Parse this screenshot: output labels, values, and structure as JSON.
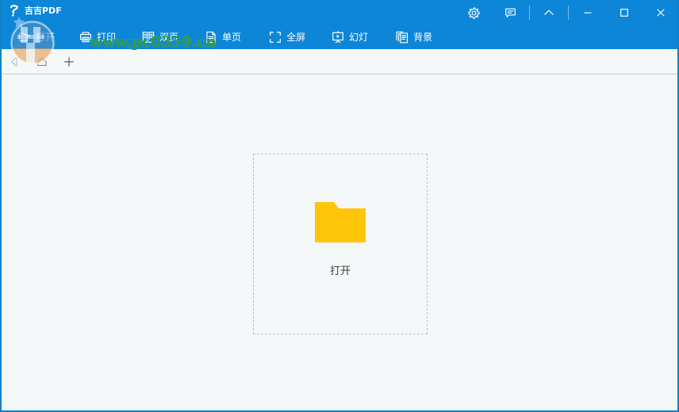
{
  "window": {
    "title": "吉吉PDF",
    "logo_icon": "jiji-pdf-logo-icon",
    "accent_color": "#0d86d8",
    "border_color": "#1081c6",
    "controls": [
      {
        "name": "settings",
        "icon": "gear-icon",
        "label": "设置"
      },
      {
        "name": "feedback",
        "icon": "chat-bubble-icon",
        "label": "反馈"
      },
      {
        "name": "collapse",
        "icon": "chevron-up-icon",
        "label": "收起"
      },
      {
        "name": "minimize",
        "icon": "minimize-icon",
        "label": "最小化"
      },
      {
        "name": "maximize",
        "icon": "maximize-icon",
        "label": "最大化"
      },
      {
        "name": "close",
        "icon": "close-icon",
        "label": "关闭"
      }
    ]
  },
  "toolbar": {
    "items": [
      {
        "id": "open",
        "label": "打开",
        "icon": "open-folder-icon"
      },
      {
        "id": "print",
        "label": "打印",
        "icon": "printer-icon"
      },
      {
        "id": "dual-page",
        "label": "双页",
        "icon": "two-page-icon"
      },
      {
        "id": "single-page",
        "label": "单页",
        "icon": "one-page-icon"
      },
      {
        "id": "fullscreen",
        "label": "全屏",
        "icon": "fullscreen-icon"
      },
      {
        "id": "slideshow",
        "label": "幻灯",
        "icon": "slideshow-icon"
      },
      {
        "id": "background",
        "label": "背景",
        "icon": "background-layers-icon"
      }
    ]
  },
  "navbar": {
    "items": [
      {
        "id": "back",
        "icon": "back-arrow-icon",
        "label": "后退",
        "enabled": false
      },
      {
        "id": "home",
        "icon": "home-icon",
        "label": "主页",
        "enabled": true
      },
      {
        "id": "new-tab",
        "icon": "plus-icon",
        "label": "新建标签",
        "enabled": true
      }
    ]
  },
  "main": {
    "dropzone": {
      "icon": "yellow-folder-icon",
      "label": "打开",
      "folder_color": "#ffc609",
      "folder_tab_color": "#eda200",
      "border_color": "#b9c2c6"
    },
    "background_color": "#f4f7f8"
  },
  "watermark": {
    "text": "www.pc0359.cn",
    "color": "#2f9b3a",
    "logo_icon": "site-watermark-logo-icon"
  }
}
